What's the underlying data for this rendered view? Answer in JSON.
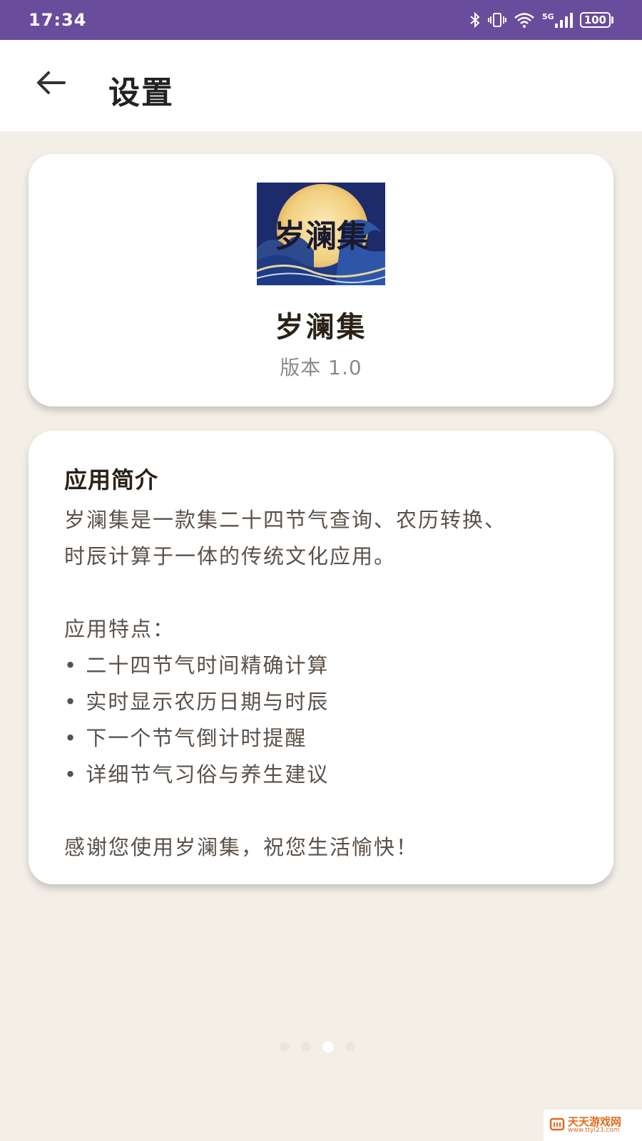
{
  "status_bar": {
    "time": "17:34",
    "network": "5G",
    "battery": "100",
    "icons": [
      "bluetooth-icon",
      "vibrate-icon",
      "wifi-icon",
      "signal-icon",
      "battery-icon"
    ]
  },
  "app_bar": {
    "title": "设置",
    "back_icon": "arrow-left-icon"
  },
  "about": {
    "logo_text": "岁澜集",
    "app_name": "岁澜集",
    "version": "版本 1.0"
  },
  "intro": {
    "title": "应用简介",
    "description_line1": "岁澜集是一款集二十四节气查询、农历转换、",
    "description_line2": "时辰计算于一体的传统文化应用。",
    "features_title": "应用特点：",
    "features": [
      "• 二十四节气时间精确计算",
      "• 实时显示农历日期与时辰",
      "• 下一个节气倒计时提醒",
      "• 详细节气习俗与养生建议"
    ],
    "thanks": "感谢您使用岁澜集，祝您生活愉快！"
  },
  "pager": {
    "count": 4,
    "active": 3
  },
  "watermark": {
    "cn": "天天游戏网",
    "en": "www.ttyl23.com"
  },
  "colors": {
    "status_bar": "#6a4c9c",
    "background": "#f3efe7",
    "card": "#ffffff",
    "title_text": "#2a2118",
    "body_text": "#5a514a",
    "muted_text": "#8f8a85"
  }
}
